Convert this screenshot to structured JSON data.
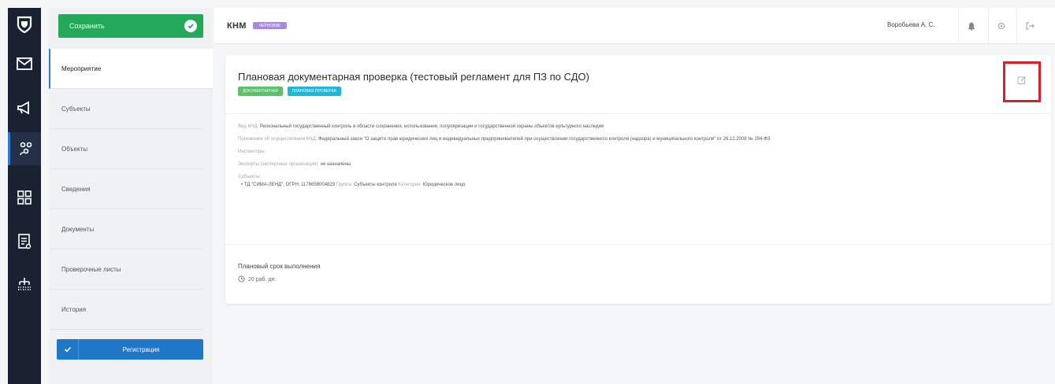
{
  "sidebar": {
    "save_label": "Сохранить",
    "nav": [
      "Мероприятие",
      "Субъекты",
      "Объекты",
      "Сведения",
      "Документы",
      "Проверочные листы",
      "История"
    ],
    "register_label": "Регистрация"
  },
  "header": {
    "crumb": "КНМ",
    "badge": "ЧЕРНОВИК",
    "user": "Воробьева А. С."
  },
  "main": {
    "title": "Плановая документарная проверка (тестовый регламент для ПЗ по СДО)",
    "tags": [
      "ДОКУМЕНТАРНАЯ",
      "ПЛАНОВАЯ ПРОВЕРКА"
    ],
    "kind_key": "Вид КНД:",
    "kind_val": "Региональный государственный контроль в области сохранения, использования, популяризации и государственной охраны объектов культурного наследия",
    "regulation_key": "Положение об осуществлении КНД:",
    "regulation_val": "Федеральный закон \"О защите прав юридических лиц и индивидуальных предпринимателей при осуществлении государственного контроля (надзора) и муниципального контроля\" от 26.12.2008 № 294-ФЗ",
    "inspectors_key": "Инспекторы:",
    "experts_key": "Эксперты (экспертные организации):",
    "experts_val": "не назначены",
    "subjects_key": "Субъекты:",
    "subject_name": "ТД \"СИМА-ЛЕНД\", ОГРН: 1176658004829",
    "subject_group_key": "Группа:",
    "subject_group_val": "Субъекты контроля",
    "subject_cat_key": "Категория:",
    "subject_cat_val": "Юридическое лицо",
    "deadline_title": "Плановый срок выполнения",
    "deadline_val": "20 раб. дн."
  },
  "colors": {
    "rail": "#1a2130",
    "save": "#24a85a",
    "register": "#1f77c8",
    "highlight": "#d7222d",
    "tag_green": "#5cbf6a",
    "tag_cyan": "#21b5d8",
    "badge": "#a78bda"
  },
  "icons": [
    "shield-logo-icon",
    "mail-icon",
    "megaphone-icon",
    "people-icon",
    "grid-icon",
    "document-icon",
    "hierarchy-icon",
    "bell-icon",
    "settings-icon",
    "logout-icon",
    "edit-icon",
    "clock-icon",
    "check-icon"
  ]
}
